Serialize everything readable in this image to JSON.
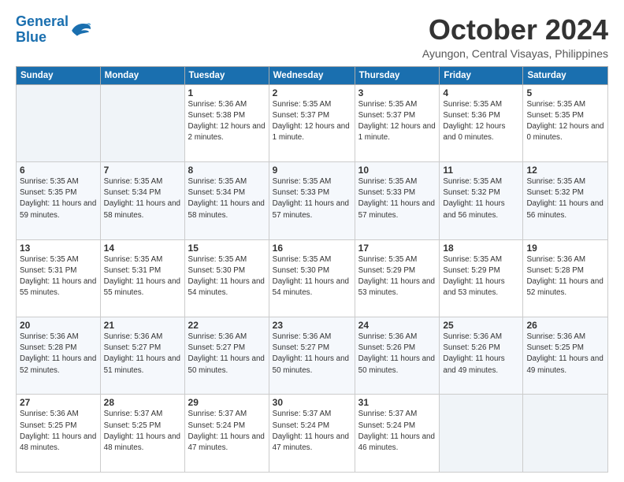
{
  "header": {
    "logo_line1": "General",
    "logo_line2": "Blue",
    "month": "October 2024",
    "location": "Ayungon, Central Visayas, Philippines"
  },
  "weekdays": [
    "Sunday",
    "Monday",
    "Tuesday",
    "Wednesday",
    "Thursday",
    "Friday",
    "Saturday"
  ],
  "weeks": [
    [
      null,
      null,
      {
        "day": "1",
        "sunrise": "Sunrise: 5:36 AM",
        "sunset": "Sunset: 5:38 PM",
        "daylight": "Daylight: 12 hours and 2 minutes."
      },
      {
        "day": "2",
        "sunrise": "Sunrise: 5:35 AM",
        "sunset": "Sunset: 5:37 PM",
        "daylight": "Daylight: 12 hours and 1 minute."
      },
      {
        "day": "3",
        "sunrise": "Sunrise: 5:35 AM",
        "sunset": "Sunset: 5:37 PM",
        "daylight": "Daylight: 12 hours and 1 minute."
      },
      {
        "day": "4",
        "sunrise": "Sunrise: 5:35 AM",
        "sunset": "Sunset: 5:36 PM",
        "daylight": "Daylight: 12 hours and 0 minutes."
      },
      {
        "day": "5",
        "sunrise": "Sunrise: 5:35 AM",
        "sunset": "Sunset: 5:35 PM",
        "daylight": "Daylight: 12 hours and 0 minutes."
      }
    ],
    [
      {
        "day": "6",
        "sunrise": "Sunrise: 5:35 AM",
        "sunset": "Sunset: 5:35 PM",
        "daylight": "Daylight: 11 hours and 59 minutes."
      },
      {
        "day": "7",
        "sunrise": "Sunrise: 5:35 AM",
        "sunset": "Sunset: 5:34 PM",
        "daylight": "Daylight: 11 hours and 58 minutes."
      },
      {
        "day": "8",
        "sunrise": "Sunrise: 5:35 AM",
        "sunset": "Sunset: 5:34 PM",
        "daylight": "Daylight: 11 hours and 58 minutes."
      },
      {
        "day": "9",
        "sunrise": "Sunrise: 5:35 AM",
        "sunset": "Sunset: 5:33 PM",
        "daylight": "Daylight: 11 hours and 57 minutes."
      },
      {
        "day": "10",
        "sunrise": "Sunrise: 5:35 AM",
        "sunset": "Sunset: 5:33 PM",
        "daylight": "Daylight: 11 hours and 57 minutes."
      },
      {
        "day": "11",
        "sunrise": "Sunrise: 5:35 AM",
        "sunset": "Sunset: 5:32 PM",
        "daylight": "Daylight: 11 hours and 56 minutes."
      },
      {
        "day": "12",
        "sunrise": "Sunrise: 5:35 AM",
        "sunset": "Sunset: 5:32 PM",
        "daylight": "Daylight: 11 hours and 56 minutes."
      }
    ],
    [
      {
        "day": "13",
        "sunrise": "Sunrise: 5:35 AM",
        "sunset": "Sunset: 5:31 PM",
        "daylight": "Daylight: 11 hours and 55 minutes."
      },
      {
        "day": "14",
        "sunrise": "Sunrise: 5:35 AM",
        "sunset": "Sunset: 5:31 PM",
        "daylight": "Daylight: 11 hours and 55 minutes."
      },
      {
        "day": "15",
        "sunrise": "Sunrise: 5:35 AM",
        "sunset": "Sunset: 5:30 PM",
        "daylight": "Daylight: 11 hours and 54 minutes."
      },
      {
        "day": "16",
        "sunrise": "Sunrise: 5:35 AM",
        "sunset": "Sunset: 5:30 PM",
        "daylight": "Daylight: 11 hours and 54 minutes."
      },
      {
        "day": "17",
        "sunrise": "Sunrise: 5:35 AM",
        "sunset": "Sunset: 5:29 PM",
        "daylight": "Daylight: 11 hours and 53 minutes."
      },
      {
        "day": "18",
        "sunrise": "Sunrise: 5:35 AM",
        "sunset": "Sunset: 5:29 PM",
        "daylight": "Daylight: 11 hours and 53 minutes."
      },
      {
        "day": "19",
        "sunrise": "Sunrise: 5:36 AM",
        "sunset": "Sunset: 5:28 PM",
        "daylight": "Daylight: 11 hours and 52 minutes."
      }
    ],
    [
      {
        "day": "20",
        "sunrise": "Sunrise: 5:36 AM",
        "sunset": "Sunset: 5:28 PM",
        "daylight": "Daylight: 11 hours and 52 minutes."
      },
      {
        "day": "21",
        "sunrise": "Sunrise: 5:36 AM",
        "sunset": "Sunset: 5:27 PM",
        "daylight": "Daylight: 11 hours and 51 minutes."
      },
      {
        "day": "22",
        "sunrise": "Sunrise: 5:36 AM",
        "sunset": "Sunset: 5:27 PM",
        "daylight": "Daylight: 11 hours and 50 minutes."
      },
      {
        "day": "23",
        "sunrise": "Sunrise: 5:36 AM",
        "sunset": "Sunset: 5:27 PM",
        "daylight": "Daylight: 11 hours and 50 minutes."
      },
      {
        "day": "24",
        "sunrise": "Sunrise: 5:36 AM",
        "sunset": "Sunset: 5:26 PM",
        "daylight": "Daylight: 11 hours and 50 minutes."
      },
      {
        "day": "25",
        "sunrise": "Sunrise: 5:36 AM",
        "sunset": "Sunset: 5:26 PM",
        "daylight": "Daylight: 11 hours and 49 minutes."
      },
      {
        "day": "26",
        "sunrise": "Sunrise: 5:36 AM",
        "sunset": "Sunset: 5:25 PM",
        "daylight": "Daylight: 11 hours and 49 minutes."
      }
    ],
    [
      {
        "day": "27",
        "sunrise": "Sunrise: 5:36 AM",
        "sunset": "Sunset: 5:25 PM",
        "daylight": "Daylight: 11 hours and 48 minutes."
      },
      {
        "day": "28",
        "sunrise": "Sunrise: 5:37 AM",
        "sunset": "Sunset: 5:25 PM",
        "daylight": "Daylight: 11 hours and 48 minutes."
      },
      {
        "day": "29",
        "sunrise": "Sunrise: 5:37 AM",
        "sunset": "Sunset: 5:24 PM",
        "daylight": "Daylight: 11 hours and 47 minutes."
      },
      {
        "day": "30",
        "sunrise": "Sunrise: 5:37 AM",
        "sunset": "Sunset: 5:24 PM",
        "daylight": "Daylight: 11 hours and 47 minutes."
      },
      {
        "day": "31",
        "sunrise": "Sunrise: 5:37 AM",
        "sunset": "Sunset: 5:24 PM",
        "daylight": "Daylight: 11 hours and 46 minutes."
      },
      null,
      null
    ]
  ]
}
